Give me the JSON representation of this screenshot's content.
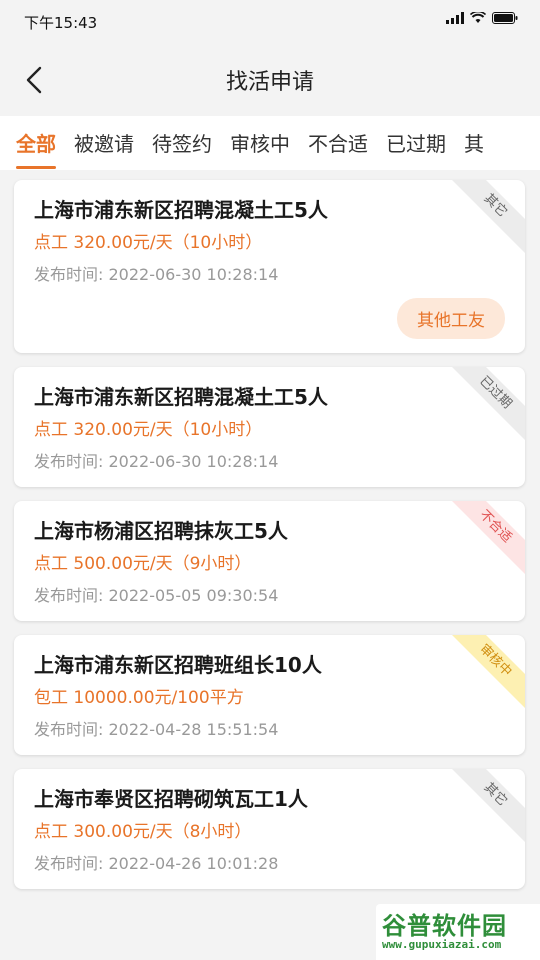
{
  "status_bar": {
    "time": "下午15:43"
  },
  "header": {
    "title": "找活申请"
  },
  "tabs": [
    {
      "label": "全部",
      "active": true
    },
    {
      "label": "被邀请"
    },
    {
      "label": "待签约"
    },
    {
      "label": "审核中"
    },
    {
      "label": "不合适"
    },
    {
      "label": "已过期"
    },
    {
      "label": "其"
    }
  ],
  "cards": [
    {
      "title": "上海市浦东新区招聘混凝土工5人",
      "pay": "点工 320.00元/天（10小时）",
      "time": "发布时间:  2022-06-30 10:28:14",
      "tag": "其它",
      "action": "其他工友"
    },
    {
      "title": "上海市浦东新区招聘混凝土工5人",
      "pay": "点工 320.00元/天（10小时）",
      "time": "发布时间:  2022-06-30 10:28:14",
      "tag": "已过期"
    },
    {
      "title": "上海市杨浦区招聘抹灰工5人",
      "pay": "点工 500.00元/天（9小时）",
      "time": "发布时间:  2022-05-05 09:30:54",
      "tag": "不合适"
    },
    {
      "title": "上海市浦东新区招聘班组长10人",
      "pay": "包工 10000.00元/100平方",
      "time": "发布时间:  2022-04-28 15:51:54",
      "tag": "审核中"
    },
    {
      "title": "上海市奉贤区招聘砌筑瓦工1人",
      "pay": "点工 300.00元/天（8小时）",
      "time": "发布时间:  2022-04-26 10:01:28",
      "tag": "其它"
    }
  ],
  "watermark": {
    "text": "谷普软件园",
    "url": "www.gupuxiazai.com"
  },
  "colors": {
    "accent": "#e8742a",
    "tag_gray": "#ececec",
    "tag_pink": "#fde4e4",
    "tag_yellow": "#fdf0b2"
  }
}
